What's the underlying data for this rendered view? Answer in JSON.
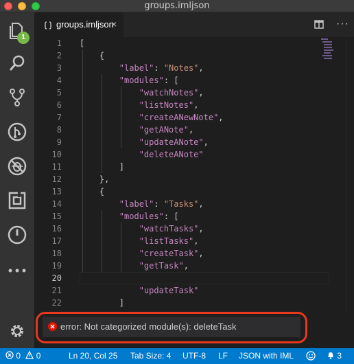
{
  "window": {
    "title": "groups.imljson"
  },
  "activity_bar": {
    "items": [
      {
        "name": "explorer-icon",
        "badge": "1"
      },
      {
        "name": "search-icon"
      },
      {
        "name": "source-control-icon"
      },
      {
        "name": "git-icon"
      },
      {
        "name": "debug-icon"
      },
      {
        "name": "extensions-icon"
      },
      {
        "name": "power-icon"
      },
      {
        "name": "ellipsis-icon"
      }
    ],
    "settings_icon": "gear-icon"
  },
  "tab": {
    "label": "groups.imljson",
    "icon": "json-braces-icon",
    "close": "×"
  },
  "editor": {
    "active_line": "20",
    "lines": [
      {
        "n": "1",
        "text": "["
      },
      {
        "n": "2",
        "text": "    {"
      },
      {
        "n": "3",
        "key": "\"label\"",
        "value": "\"Notes\"",
        "indent": "        ",
        "suffix": ","
      },
      {
        "n": "4",
        "key": "\"modules\"",
        "value": "[",
        "indent": "        ",
        "suffix": ""
      },
      {
        "n": "5",
        "str": "\"watchNotes\"",
        "indent": "            ",
        "suffix": ","
      },
      {
        "n": "6",
        "str": "\"listNotes\"",
        "indent": "            ",
        "suffix": ","
      },
      {
        "n": "7",
        "str": "\"createANewNote\"",
        "indent": "            ",
        "suffix": ","
      },
      {
        "n": "8",
        "str": "\"getANote\"",
        "indent": "            ",
        "suffix": ","
      },
      {
        "n": "9",
        "str": "\"updateANote\"",
        "indent": "            ",
        "suffix": ","
      },
      {
        "n": "10",
        "str": "\"deleteANote\"",
        "indent": "            ",
        "suffix": ""
      },
      {
        "n": "11",
        "text": "        ]"
      },
      {
        "n": "12",
        "text": "    },"
      },
      {
        "n": "13",
        "text": "    {"
      },
      {
        "n": "14",
        "key": "\"label\"",
        "value": "\"Tasks\"",
        "indent": "        ",
        "suffix": ","
      },
      {
        "n": "15",
        "key": "\"modules\"",
        "value": "[",
        "indent": "        ",
        "suffix": ""
      },
      {
        "n": "16",
        "str": "\"watchTasks\"",
        "indent": "            ",
        "suffix": ","
      },
      {
        "n": "17",
        "str": "\"listTasks\"",
        "indent": "            ",
        "suffix": ","
      },
      {
        "n": "18",
        "str": "\"createTask\"",
        "indent": "            ",
        "suffix": ","
      },
      {
        "n": "19",
        "str": "\"getTask\"",
        "indent": "            ",
        "suffix": ","
      },
      {
        "n": "20",
        "text": ""
      },
      {
        "n": "21",
        "str": "\"updateTask\"",
        "indent": "            ",
        "suffix": ""
      },
      {
        "n": "22",
        "text": "        ]"
      }
    ]
  },
  "popup": {
    "severity": "error",
    "message": "error: Not categorized module(s): deleteTask"
  },
  "statusbar": {
    "errors": "0",
    "warnings": "0",
    "position": "Ln 20, Col 25",
    "tab_size": "Tab Size: 4",
    "encoding": "UTF-8",
    "eol": "LF",
    "language": "JSON with IML",
    "notifications": "3"
  },
  "colors": {
    "accent": "#007acc",
    "error": "#e8381e",
    "badge": "#78b94a"
  }
}
